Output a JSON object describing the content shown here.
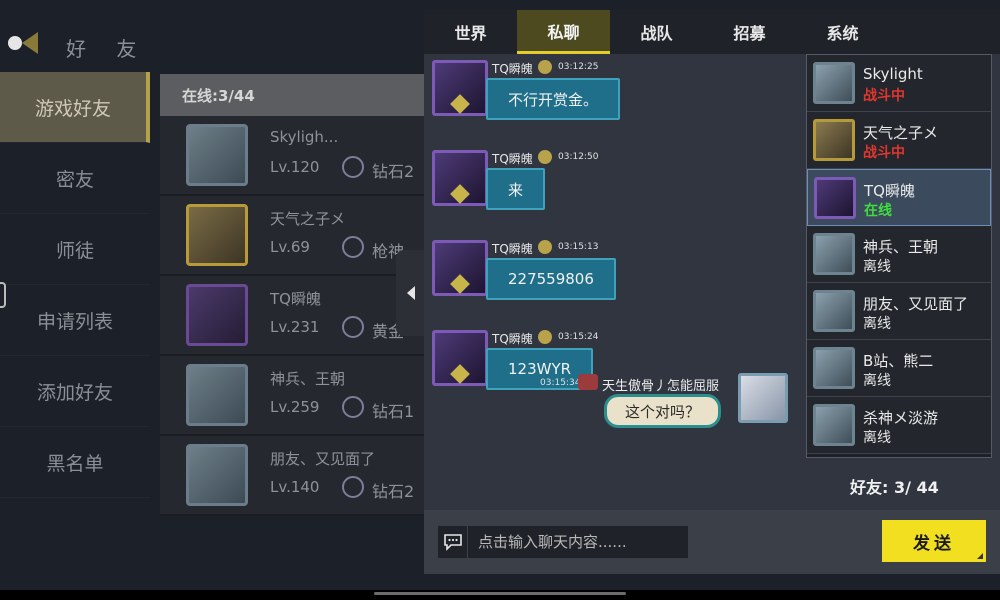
{
  "left_screen": {
    "heading": "好 友",
    "nav": [
      "游戏好友",
      "密友",
      "师徒",
      "申请列表",
      "添加好友",
      "黑名单"
    ],
    "online_header": "在线:3/44",
    "friends": [
      {
        "name": "Skyligh...",
        "level": "Lv.120",
        "rank": "钻石2",
        "frame": "default"
      },
      {
        "name": "天气之子メ",
        "level": "Lv.69",
        "rank": "枪神",
        "frame": "gold"
      },
      {
        "name": "TQ瞬魄",
        "level": "Lv.231",
        "rank": "黄金",
        "frame": "purple"
      },
      {
        "name": "神兵、王朝",
        "level": "Lv.259",
        "rank": "钻石1",
        "frame": "default"
      },
      {
        "name": "朋友、又见面了",
        "level": "Lv.140",
        "rank": "钻石2",
        "frame": "default"
      }
    ]
  },
  "chat": {
    "tabs": [
      "世界",
      "私聊",
      "战队",
      "招募",
      "系统"
    ],
    "active_tab": "私聊",
    "messages": [
      {
        "sender": "TQ瞬魄",
        "time": "03:12:25",
        "text": "不行开赏金。"
      },
      {
        "sender": "TQ瞬魄",
        "time": "03:12:50",
        "text": "来"
      },
      {
        "sender": "TQ瞬魄",
        "time": "03:15:13",
        "text": "227559806"
      },
      {
        "sender": "TQ瞬魄",
        "time": "03:15:24",
        "text": "123WYR"
      }
    ],
    "my_message": {
      "sender": "天生傲骨丿怎能屈服",
      "time": "03:15:34",
      "text": "这个对吗？"
    },
    "contacts": [
      {
        "name": "Skylight",
        "status": "战斗中",
        "status_type": "fight",
        "frame": "default"
      },
      {
        "name": "天气之子メ",
        "status": "战斗中",
        "status_type": "fight",
        "frame": "gold"
      },
      {
        "name": "TQ瞬魄",
        "status": "在线",
        "status_type": "online",
        "frame": "purple",
        "selected": true
      },
      {
        "name": "神兵、王朝",
        "status": "离线",
        "status_type": "offline",
        "frame": "default"
      },
      {
        "name": "朋友、又见面了",
        "status": "离线",
        "status_type": "offline",
        "frame": "default"
      },
      {
        "name": "B站、熊二",
        "status": "离线",
        "status_type": "offline",
        "frame": "default"
      },
      {
        "name": "杀神メ淡游",
        "status": "离线",
        "status_type": "offline",
        "frame": "default"
      }
    ],
    "friend_count": "好友: 3/ 44",
    "input_placeholder": "点击输入聊天内容......",
    "send_label": "发送"
  },
  "colors": {
    "accent_yellow": "#f2e020",
    "bubble_teal": "#1f6f8a",
    "status_fight": "#e0362e",
    "status_online": "#3fdd3f"
  }
}
